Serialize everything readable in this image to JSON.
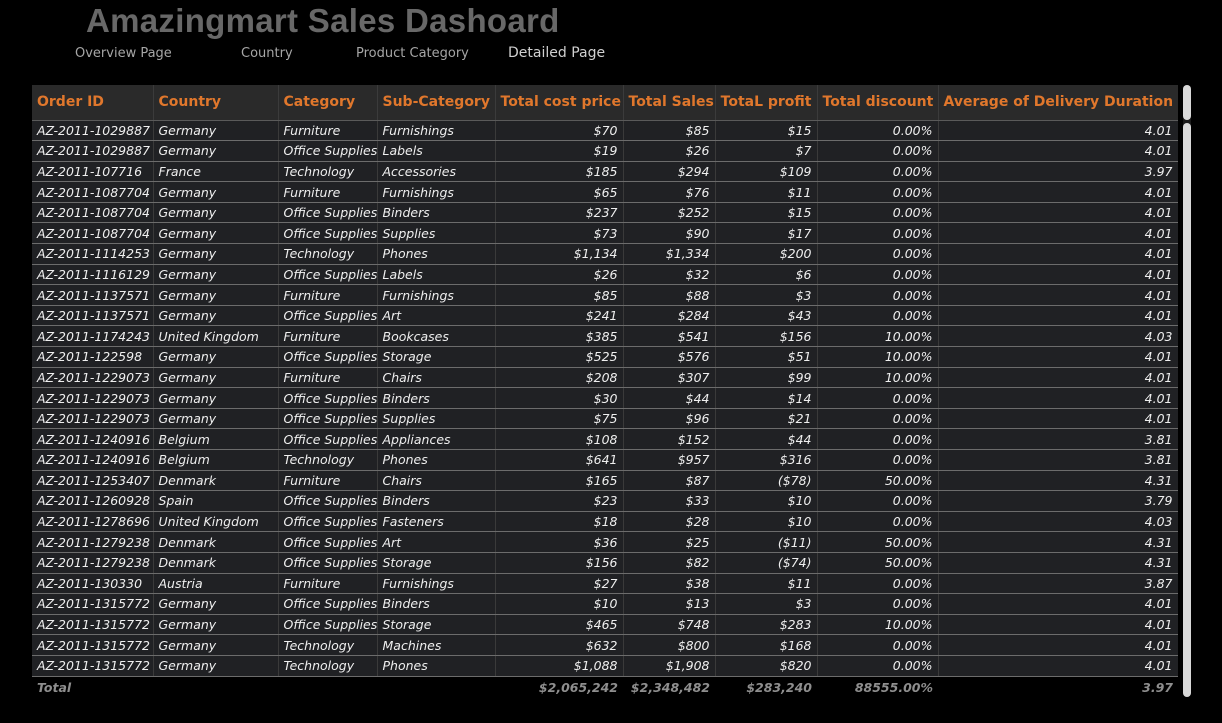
{
  "header": {
    "title": "Amazingmart Sales Dashoard"
  },
  "nav": [
    {
      "label": "Overview Page"
    },
    {
      "label": "Country"
    },
    {
      "label": "Product Category"
    },
    {
      "label": "Detailed Page"
    }
  ],
  "colors": {
    "header_text": "#e0772c",
    "row_bg": "#202124",
    "page_bg": "#000000"
  },
  "table": {
    "columns": [
      "Order ID",
      "Country",
      "Category",
      "Sub-Category",
      "Total cost price",
      "Total Sales",
      "TotaL profit",
      "Total discount",
      "Average of Delivery Duration"
    ],
    "rows": [
      [
        "AZ-2011-1029887",
        "Germany",
        "Furniture",
        "Furnishings",
        "$70",
        "$85",
        "$15",
        "0.00%",
        "4.01"
      ],
      [
        "AZ-2011-1029887",
        "Germany",
        "Office Supplies",
        "Labels",
        "$19",
        "$26",
        "$7",
        "0.00%",
        "4.01"
      ],
      [
        "AZ-2011-107716",
        "France",
        "Technology",
        "Accessories",
        "$185",
        "$294",
        "$109",
        "0.00%",
        "3.97"
      ],
      [
        "AZ-2011-1087704",
        "Germany",
        "Furniture",
        "Furnishings",
        "$65",
        "$76",
        "$11",
        "0.00%",
        "4.01"
      ],
      [
        "AZ-2011-1087704",
        "Germany",
        "Office Supplies",
        "Binders",
        "$237",
        "$252",
        "$15",
        "0.00%",
        "4.01"
      ],
      [
        "AZ-2011-1087704",
        "Germany",
        "Office Supplies",
        "Supplies",
        "$73",
        "$90",
        "$17",
        "0.00%",
        "4.01"
      ],
      [
        "AZ-2011-1114253",
        "Germany",
        "Technology",
        "Phones",
        "$1,134",
        "$1,334",
        "$200",
        "0.00%",
        "4.01"
      ],
      [
        "AZ-2011-1116129",
        "Germany",
        "Office Supplies",
        "Labels",
        "$26",
        "$32",
        "$6",
        "0.00%",
        "4.01"
      ],
      [
        "AZ-2011-1137571",
        "Germany",
        "Furniture",
        "Furnishings",
        "$85",
        "$88",
        "$3",
        "0.00%",
        "4.01"
      ],
      [
        "AZ-2011-1137571",
        "Germany",
        "Office Supplies",
        "Art",
        "$241",
        "$284",
        "$43",
        "0.00%",
        "4.01"
      ],
      [
        "AZ-2011-1174243",
        "United Kingdom",
        "Furniture",
        "Bookcases",
        "$385",
        "$541",
        "$156",
        "10.00%",
        "4.03"
      ],
      [
        "AZ-2011-122598",
        "Germany",
        "Office Supplies",
        "Storage",
        "$525",
        "$576",
        "$51",
        "10.00%",
        "4.01"
      ],
      [
        "AZ-2011-1229073",
        "Germany",
        "Furniture",
        "Chairs",
        "$208",
        "$307",
        "$99",
        "10.00%",
        "4.01"
      ],
      [
        "AZ-2011-1229073",
        "Germany",
        "Office Supplies",
        "Binders",
        "$30",
        "$44",
        "$14",
        "0.00%",
        "4.01"
      ],
      [
        "AZ-2011-1229073",
        "Germany",
        "Office Supplies",
        "Supplies",
        "$75",
        "$96",
        "$21",
        "0.00%",
        "4.01"
      ],
      [
        "AZ-2011-1240916",
        "Belgium",
        "Office Supplies",
        "Appliances",
        "$108",
        "$152",
        "$44",
        "0.00%",
        "3.81"
      ],
      [
        "AZ-2011-1240916",
        "Belgium",
        "Technology",
        "Phones",
        "$641",
        "$957",
        "$316",
        "0.00%",
        "3.81"
      ],
      [
        "AZ-2011-1253407",
        "Denmark",
        "Furniture",
        "Chairs",
        "$165",
        "$87",
        "($78)",
        "50.00%",
        "4.31"
      ],
      [
        "AZ-2011-1260928",
        "Spain",
        "Office Supplies",
        "Binders",
        "$23",
        "$33",
        "$10",
        "0.00%",
        "3.79"
      ],
      [
        "AZ-2011-1278696",
        "United Kingdom",
        "Office Supplies",
        "Fasteners",
        "$18",
        "$28",
        "$10",
        "0.00%",
        "4.03"
      ],
      [
        "AZ-2011-1279238",
        "Denmark",
        "Office Supplies",
        "Art",
        "$36",
        "$25",
        "($11)",
        "50.00%",
        "4.31"
      ],
      [
        "AZ-2011-1279238",
        "Denmark",
        "Office Supplies",
        "Storage",
        "$156",
        "$82",
        "($74)",
        "50.00%",
        "4.31"
      ],
      [
        "AZ-2011-130330",
        "Austria",
        "Furniture",
        "Furnishings",
        "$27",
        "$38",
        "$11",
        "0.00%",
        "3.87"
      ],
      [
        "AZ-2011-1315772",
        "Germany",
        "Office Supplies",
        "Binders",
        "$10",
        "$13",
        "$3",
        "0.00%",
        "4.01"
      ],
      [
        "AZ-2011-1315772",
        "Germany",
        "Office Supplies",
        "Storage",
        "$465",
        "$748",
        "$283",
        "10.00%",
        "4.01"
      ],
      [
        "AZ-2011-1315772",
        "Germany",
        "Technology",
        "Machines",
        "$632",
        "$800",
        "$168",
        "0.00%",
        "4.01"
      ],
      [
        "AZ-2011-1315772",
        "Germany",
        "Technology",
        "Phones",
        "$1,088",
        "$1,908",
        "$820",
        "0.00%",
        "4.01"
      ]
    ],
    "totals": [
      "Total",
      "",
      "",
      "",
      "$2,065,242",
      "$2,348,482",
      "$283,240",
      "88555.00%",
      "3.97"
    ]
  }
}
